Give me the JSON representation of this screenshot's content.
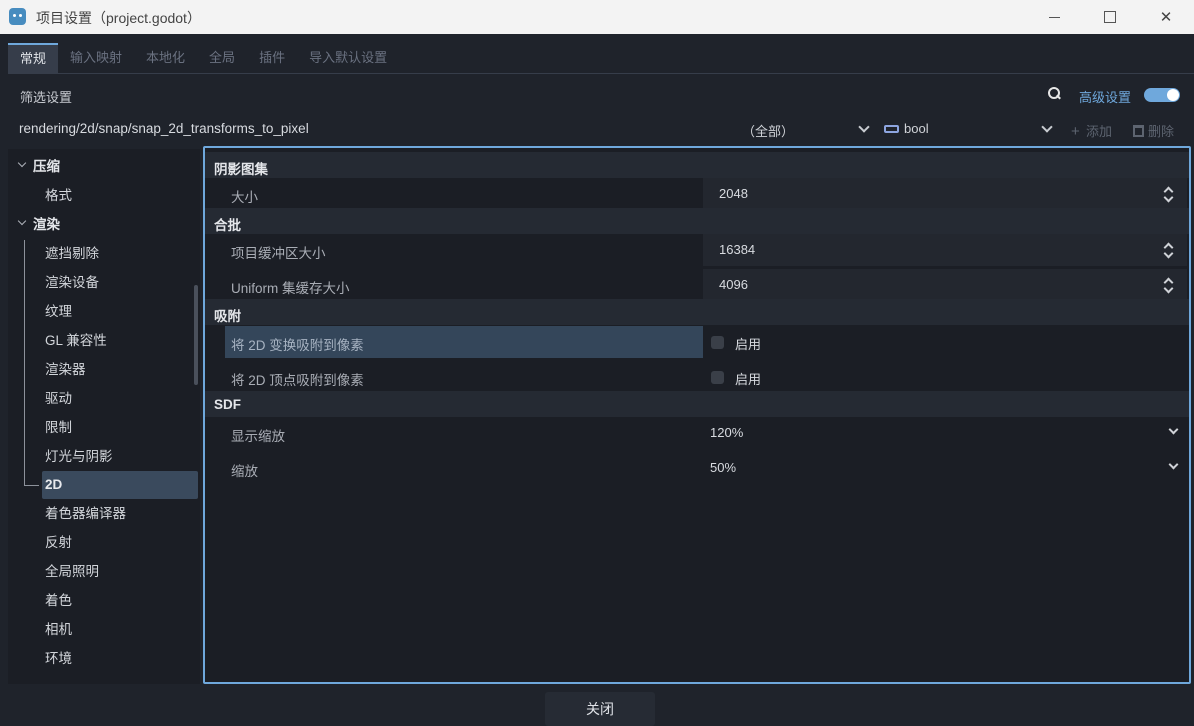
{
  "window": {
    "title": "项目设置（project.godot）"
  },
  "tabs": [
    {
      "label": "常规"
    },
    {
      "label": "输入映射"
    },
    {
      "label": "本地化"
    },
    {
      "label": "全局"
    },
    {
      "label": "插件"
    },
    {
      "label": "导入默认设置"
    }
  ],
  "filter": {
    "label": "筛选设置",
    "advanced_label": "高级设置",
    "advanced_on": true
  },
  "path_bar": {
    "path": "rendering/2d/snap/snap_2d_transforms_to_pixel",
    "category_select": "（全部）",
    "type_select": "bool",
    "add_label": "添加",
    "delete_label": "删除"
  },
  "sidebar": {
    "items": [
      {
        "label": "压缩",
        "level": 0
      },
      {
        "label": "格式",
        "level": 1
      },
      {
        "label": "渲染",
        "level": 0
      },
      {
        "label": "遮挡剔除",
        "level": 1
      },
      {
        "label": "渲染设备",
        "level": 1
      },
      {
        "label": "纹理",
        "level": 1
      },
      {
        "label": "GL 兼容性",
        "level": 1
      },
      {
        "label": "渲染器",
        "level": 1
      },
      {
        "label": "驱动",
        "level": 1
      },
      {
        "label": "限制",
        "level": 1
      },
      {
        "label": "灯光与阴影",
        "level": 1
      },
      {
        "label": "2D",
        "level": 1,
        "selected": true
      },
      {
        "label": "着色器编译器",
        "level": 1
      },
      {
        "label": "反射",
        "level": 1
      },
      {
        "label": "全局照明",
        "level": 1
      },
      {
        "label": "着色",
        "level": 1
      },
      {
        "label": "相机",
        "level": 1
      },
      {
        "label": "环境",
        "level": 1
      }
    ]
  },
  "panel": {
    "sections": [
      {
        "title": "阴影图集",
        "rows": [
          {
            "label": "大小",
            "value": "2048",
            "kind": "spin"
          }
        ]
      },
      {
        "title": "合批",
        "rows": [
          {
            "label": "项目缓冲区大小",
            "value": "16384",
            "kind": "spin"
          },
          {
            "label": "Uniform 集缓存大小",
            "value": "4096",
            "kind": "spin"
          }
        ]
      },
      {
        "title": "吸附",
        "rows": [
          {
            "label": "将 2D 变换吸附到像素",
            "value": "启用",
            "kind": "check",
            "highlight": true
          },
          {
            "label": "将 2D 顶点吸附到像素",
            "value": "启用",
            "kind": "check"
          }
        ]
      },
      {
        "title": "SDF",
        "rows": [
          {
            "label": "显示缩放",
            "value": "120%",
            "kind": "dropdown"
          },
          {
            "label": "缩放",
            "value": "50%",
            "kind": "dropdown"
          }
        ]
      }
    ]
  },
  "footer": {
    "close_label": "关闭"
  },
  "colors": {
    "accent": "#6fa8dc",
    "background": "#1f232b",
    "panel": "#1b1e25",
    "selected": "#3a4a5d"
  }
}
